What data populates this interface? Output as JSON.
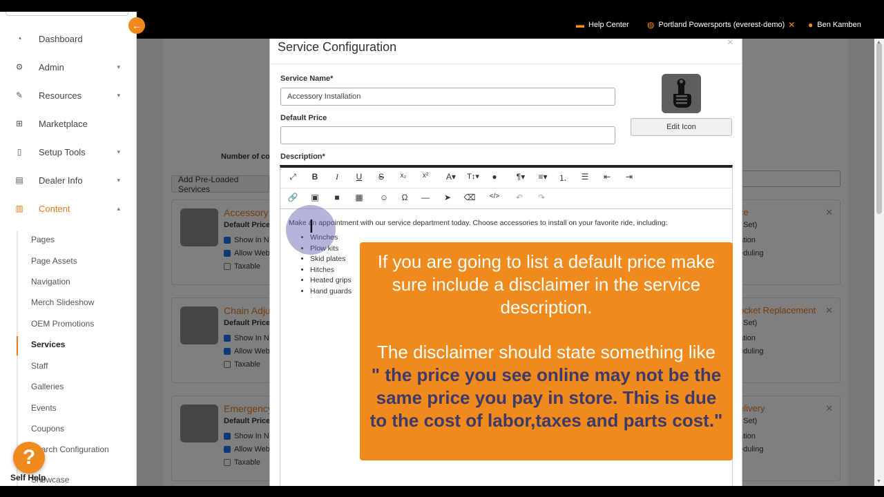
{
  "sidebar": {
    "items": [
      {
        "label": "Dashboard",
        "icon": "dashboard-icon",
        "has_chevron": false
      },
      {
        "label": "Admin",
        "icon": "admin-gears-icon",
        "has_chevron": true
      },
      {
        "label": "Resources",
        "icon": "wrench-icon",
        "has_chevron": true
      },
      {
        "label": "Marketplace",
        "icon": "basket-icon",
        "has_chevron": false
      },
      {
        "label": "Setup Tools",
        "icon": "setup-icon",
        "has_chevron": true
      },
      {
        "label": "Dealer Info",
        "icon": "dealer-icon",
        "has_chevron": true
      },
      {
        "label": "Content",
        "icon": "content-icon",
        "has_chevron": true,
        "expanded": true
      }
    ],
    "subitems": [
      "Pages",
      "Page Assets",
      "Navigation",
      "Merch Slideshow",
      "OEM Promotions",
      "Services",
      "Staff",
      "Galleries",
      "Events",
      "Coupons",
      "Search Configuration",
      "Showcase"
    ],
    "active_subitem": "Services",
    "help_label": "Self Help",
    "accent": "#e8791b"
  },
  "header": {
    "help_center": "Help Center",
    "dealer": "Portland Powersports (everest-demo)",
    "user": "Ben Kamben"
  },
  "background": {
    "number_label": "Number of co",
    "preloaded_button": "Add Pre-Loaded Services",
    "cards_left": [
      {
        "title": "Accessory",
        "price_label": "Default Price:",
        "opt1": "Show In Na",
        "opt2": "Allow Web",
        "opt3": "Taxable"
      },
      {
        "title": "Chain Adju",
        "price_label": "Default Price:",
        "opt1": "Show In Na",
        "opt2": "Allow Web",
        "opt3": "Taxable"
      },
      {
        "title": "Emergency",
        "price_label": "Default Price:",
        "opt1": "Show In Na",
        "opt2": "Allow Web",
        "opt3": "Taxable"
      }
    ],
    "cards_right": [
      {
        "title": "ce",
        "line1": "t Set)",
        "line2": "ation",
        "line3": "eduling"
      },
      {
        "title": "ocket Replacement",
        "line1": "t Set)",
        "line2": "ation",
        "line3": "eduling"
      },
      {
        "title": "elivery",
        "line1": "t Set)",
        "line2": "ation",
        "line3": "eduling"
      }
    ]
  },
  "modal": {
    "title": "Service Configuration",
    "close": "×",
    "service_name_label": "Service Name*",
    "service_name_value": "Accessory Installation",
    "default_price_label": "Default Price",
    "default_price_value": "",
    "edit_icon_label": "Edit Icon",
    "description_label": "Description*",
    "toolbar_row1": [
      "expand",
      "bold",
      "italic",
      "underline",
      "strikethrough",
      "subscript",
      "superscript",
      "font",
      "text-size",
      "color",
      "paragraph",
      "align",
      "ordered-list",
      "unordered-list",
      "outdent",
      "indent"
    ],
    "toolbar_row2": [
      "link",
      "image",
      "video",
      "table",
      "emoji",
      "special-char",
      "horizontal-line",
      "select",
      "clear-format",
      "code-view",
      "undo",
      "redo"
    ],
    "description_intro": "Make an appointment with our service department today. Choose accessories to install on your favorite ride, including:",
    "description_list": [
      "Winches",
      "Plow kits",
      "Skid plates",
      "Hitches",
      "Heated grips",
      "Hand guards"
    ]
  },
  "callout": {
    "p1": "If you are going to list a default price make sure include a disclaimer in the service description.",
    "p2": "The disclaimer should state something like",
    "quote": "\" the price you see online may not be the same price you pay in store. This is due to the cost of labor,taxes and parts cost.\"",
    "bg_color": "#f08a1c",
    "quote_color": "#3d3a6b"
  }
}
